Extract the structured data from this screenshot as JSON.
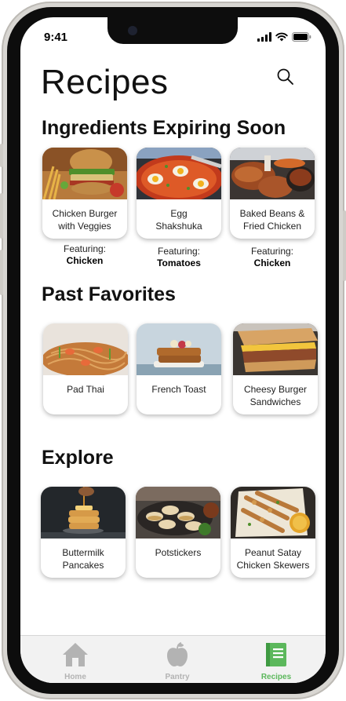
{
  "status": {
    "time": "9:41"
  },
  "header": {
    "title": "Recipes"
  },
  "sections": {
    "expiring": {
      "title": "Ingredients Expiring Soon",
      "featuring_label": "Featuring:",
      "cards": [
        {
          "line1": "Chicken Burger",
          "line2": "with Veggies",
          "featuring": "Chicken"
        },
        {
          "line1": "Egg",
          "line2": "Shakshuka",
          "featuring": "Tomatoes"
        },
        {
          "line1": "Baked Beans &",
          "line2": "Fried Chicken",
          "featuring": "Chicken"
        }
      ]
    },
    "favorites": {
      "title": "Past Favorites",
      "cards": [
        {
          "line1": "Pad Thai",
          "line2": ""
        },
        {
          "line1": "French Toast",
          "line2": ""
        },
        {
          "line1": "Cheesy Burger",
          "line2": "Sandwiches"
        }
      ]
    },
    "explore": {
      "title": "Explore",
      "cards": [
        {
          "line1": "Buttermilk",
          "line2": "Pancakes"
        },
        {
          "line1": "Potstickers",
          "line2": ""
        },
        {
          "line1": "Peanut Satay",
          "line2": "Chicken Skewers"
        }
      ]
    }
  },
  "tabbar": {
    "items": [
      {
        "label": "Home",
        "icon": "home-icon"
      },
      {
        "label": "Pantry",
        "icon": "apple-icon"
      },
      {
        "label": "Recipes",
        "icon": "recipe-book-icon"
      }
    ],
    "active_color": "#5cb85c",
    "inactive_color": "#b3b3b3"
  }
}
